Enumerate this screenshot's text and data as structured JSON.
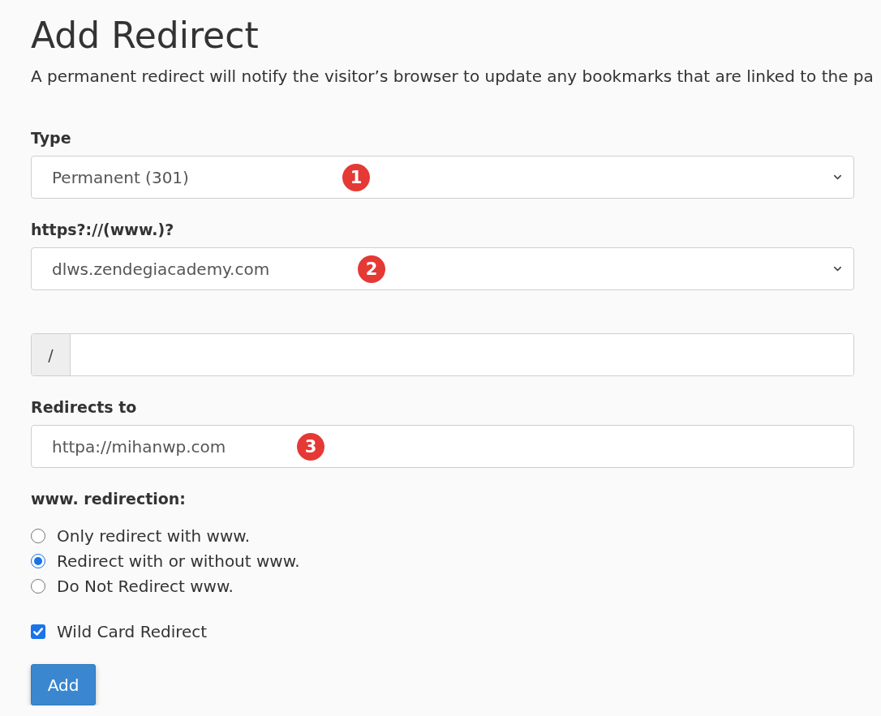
{
  "page": {
    "title": "Add Redirect",
    "description": "A permanent redirect will notify the visitor’s browser to update any bookmarks that are linked to the pa"
  },
  "fields": [
    {
      "kind": "select",
      "label": "Type",
      "value": "Permanent (301)",
      "marker": "1"
    },
    {
      "kind": "select",
      "label": "https?://(www.)?",
      "value": "dlws.zendegiacademy.com",
      "marker": "2"
    },
    {
      "kind": "path",
      "addon": "/"
    },
    {
      "kind": "text",
      "label": "Redirects to",
      "value": "httpa://mihanwp.com",
      "marker": "3"
    }
  ],
  "www_redirection": {
    "label": "www. redirection:",
    "options": [
      {
        "label": "Only redirect with www.",
        "selected": false
      },
      {
        "label": "Redirect with or without www.",
        "selected": true
      },
      {
        "label": "Do Not Redirect www.",
        "selected": false
      }
    ]
  },
  "wildcard": {
    "label": "Wild Card Redirect",
    "checked": true
  },
  "submit": {
    "label": "Add"
  }
}
